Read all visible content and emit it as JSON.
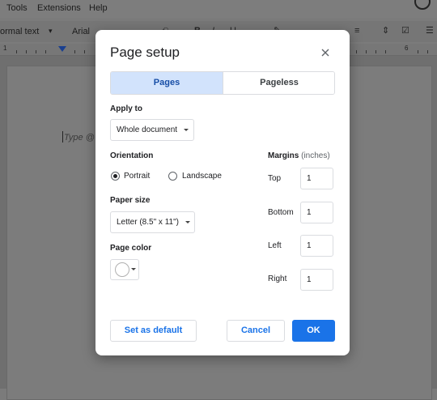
{
  "menu": {
    "items": [
      "Tools",
      "Extensions",
      "Help"
    ]
  },
  "toolbar": {
    "style_label": "ormal text",
    "font_label": "Arial"
  },
  "ruler": {
    "label_left": "1",
    "label_right": "6"
  },
  "document": {
    "placeholder": "Type @"
  },
  "dialog": {
    "title": "Page setup",
    "tabs": [
      {
        "label": "Pages",
        "selected": true
      },
      {
        "label": "Pageless",
        "selected": false
      }
    ],
    "apply_to": {
      "label": "Apply to",
      "value": "Whole document"
    },
    "orientation": {
      "label": "Orientation",
      "options": [
        {
          "label": "Portrait",
          "selected": true
        },
        {
          "label": "Landscape",
          "selected": false
        }
      ]
    },
    "paper_size": {
      "label": "Paper size",
      "value": "Letter (8.5\" x 11\")"
    },
    "page_color": {
      "label": "Page color",
      "value": "#ffffff"
    },
    "margins": {
      "label": "Margins",
      "unit": "(inches)",
      "fields": [
        {
          "label": "Top",
          "value": "1"
        },
        {
          "label": "Bottom",
          "value": "1"
        },
        {
          "label": "Left",
          "value": "1"
        },
        {
          "label": "Right",
          "value": "1"
        }
      ]
    },
    "buttons": {
      "set_default": "Set as default",
      "cancel": "Cancel",
      "ok": "OK"
    }
  },
  "colors": {
    "accent": "#1a73e8",
    "tab_selected_bg": "#d2e3fc",
    "overlay": "#7b7b7b"
  }
}
